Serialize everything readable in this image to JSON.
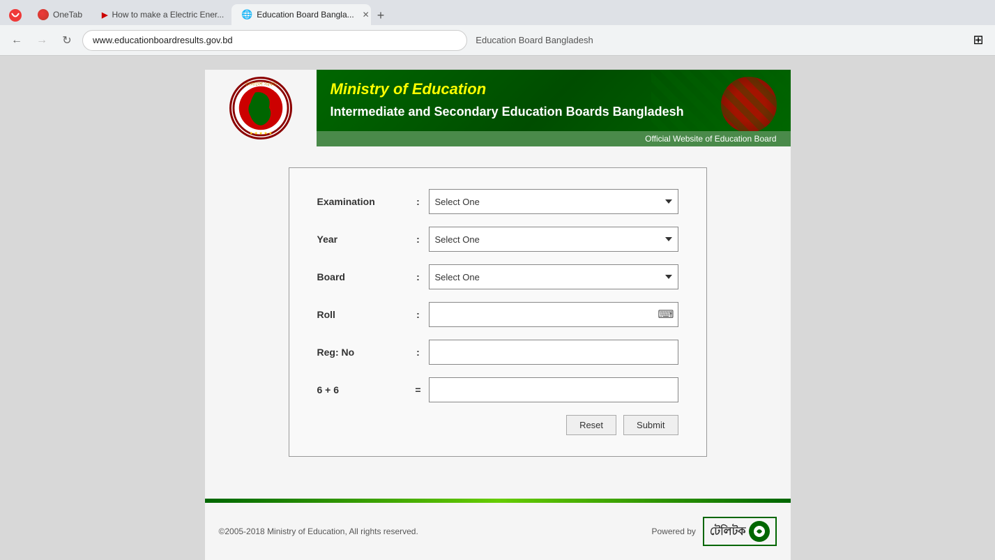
{
  "browser": {
    "tabs": [
      {
        "id": "onetab",
        "label": "OneTab",
        "icon": "vivaldi",
        "active": false,
        "closable": false
      },
      {
        "id": "youtube",
        "label": "How to make a Electric Ener...",
        "icon": "youtube",
        "active": false,
        "closable": false
      },
      {
        "id": "eduboard",
        "label": "Education Board Bangla...",
        "icon": "globe",
        "active": true,
        "closable": true
      }
    ],
    "new_tab_label": "+",
    "address": "www.educationboardresults.gov.bd",
    "page_title": "Education Board Bangladesh"
  },
  "header": {
    "ministry_title": "Ministry of Education",
    "board_title": "Intermediate and Secondary Education Boards Bangladesh",
    "official_label": "Official Website of Education Board"
  },
  "form": {
    "examination_label": "Examination",
    "year_label": "Year",
    "board_label": "Board",
    "roll_label": "Roll",
    "reg_no_label": "Reg: No",
    "captcha_label": "6 + 6",
    "captcha_equals": "=",
    "colon": ":",
    "select_placeholder": "Select One",
    "reset_label": "Reset",
    "submit_label": "Submit"
  },
  "footer": {
    "copyright": "©2005-2018 Ministry of Education, All rights reserved.",
    "powered_by": "Powered by",
    "teletalk": "টেলিটক"
  }
}
